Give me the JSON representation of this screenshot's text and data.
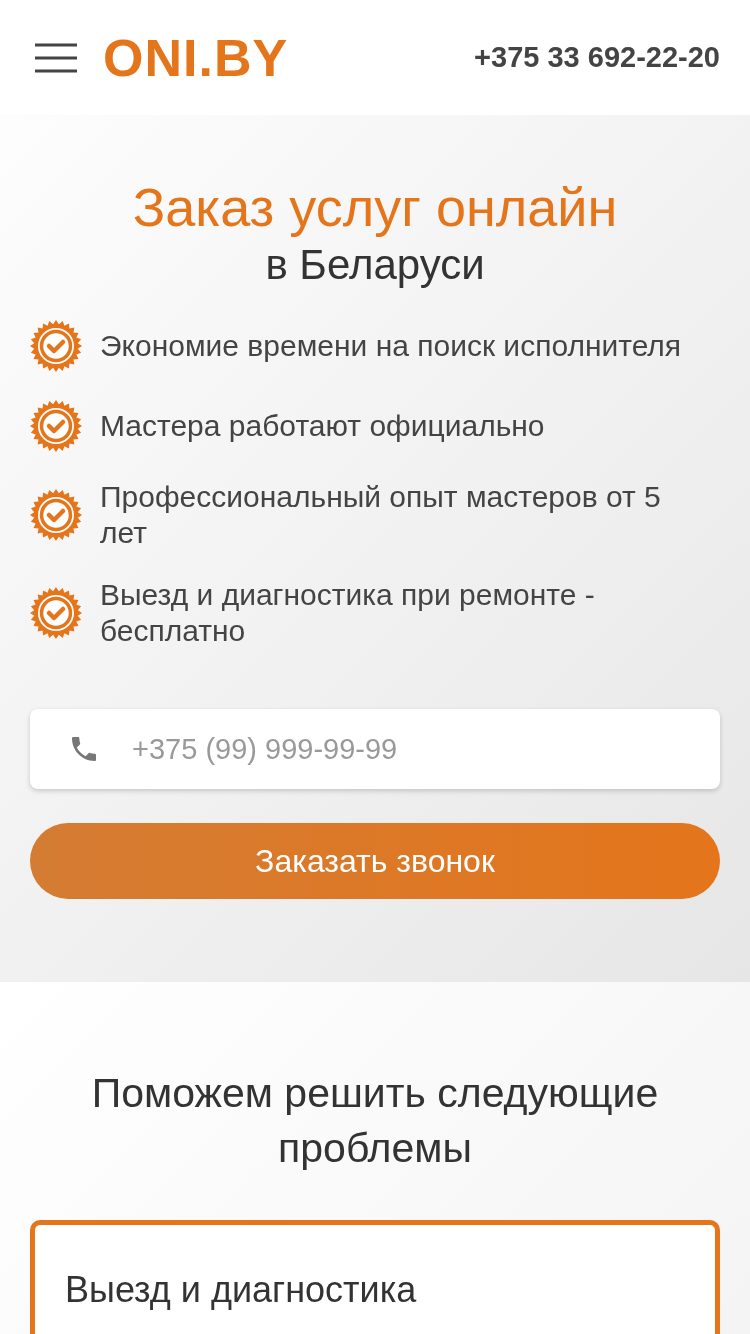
{
  "header": {
    "logo": "ONI.BY",
    "phone": "+375 33 692-22-20"
  },
  "hero": {
    "title": "Заказ услуг онлайн",
    "subtitle": "в Беларуси",
    "features": [
      "Экономие времени на поиск исполнителя",
      "Мастера работают официально",
      "Профессиональный опыт мастеров от 5 лет",
      "Выезд и диагностика при ремонте - бесплатно"
    ],
    "phone_field": {
      "placeholder": "+375 (99) 999-99-99"
    },
    "button": "Заказать звонок"
  },
  "problems": {
    "title": "Поможем решить следующие проблемы",
    "cards": [
      "Выезд и диагностика"
    ]
  }
}
